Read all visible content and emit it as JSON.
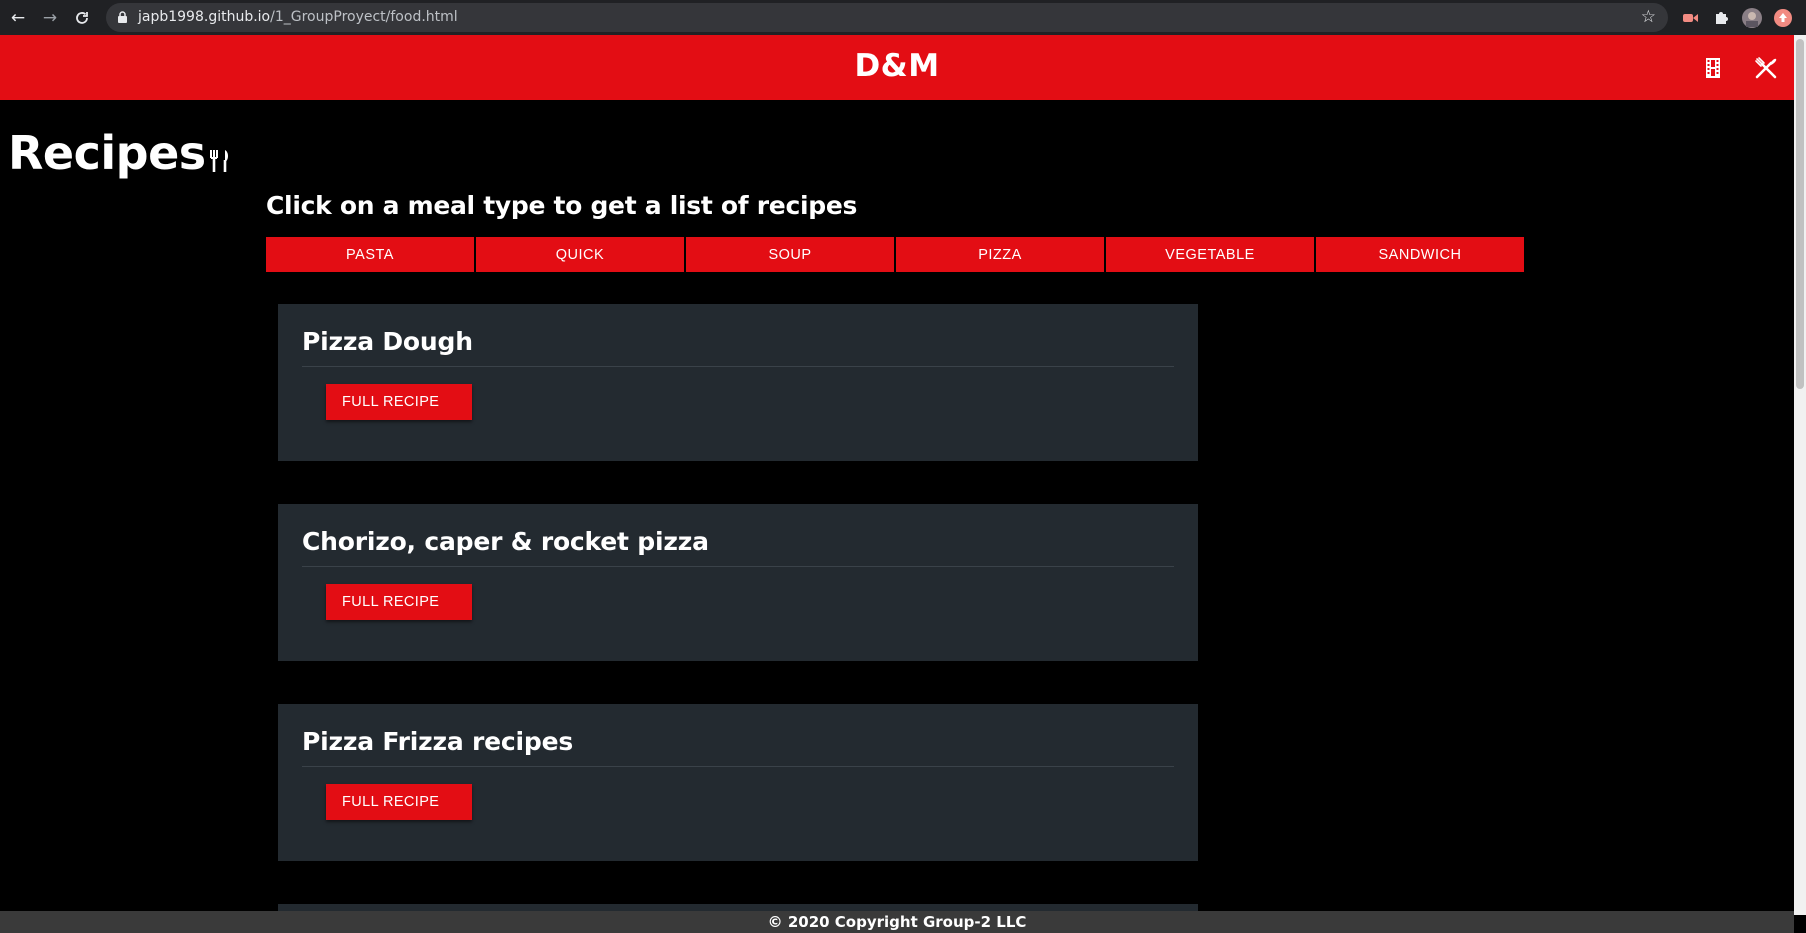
{
  "browser": {
    "url_host": "japb1998.github.io",
    "url_path": "/1_GroupProyect/food.html"
  },
  "header": {
    "brand": "D&M",
    "icons": [
      "film-icon",
      "utensils-icon"
    ]
  },
  "page": {
    "title": "Recipes",
    "subtitle": "Click on a meal type to get a list of recipes"
  },
  "meal_types": [
    "PASTA",
    "QUICK",
    "SOUP",
    "PIZZA",
    "VEGETABLE",
    "SANDWICH"
  ],
  "recipes": [
    {
      "title": "Pizza Dough",
      "button": "FULL RECIPE"
    },
    {
      "title": "Chorizo, caper & rocket pizza",
      "button": "FULL RECIPE"
    },
    {
      "title": "Pizza Frizza recipes",
      "button": "FULL RECIPE"
    }
  ],
  "footer": {
    "text": "© 2020 Copyright Group-2 LLC"
  },
  "colors": {
    "accent": "#e30d14",
    "card": "#232a30",
    "background": "#000000"
  }
}
